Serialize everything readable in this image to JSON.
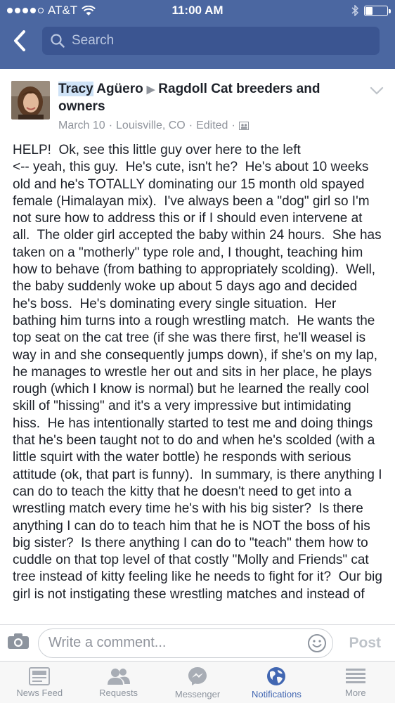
{
  "status_bar": {
    "carrier": "AT&T",
    "time": "11:00 AM",
    "battery_level": 0.3
  },
  "nav": {
    "search_placeholder": "Search"
  },
  "post": {
    "author_first": "Tracy",
    "author_rest": " Agüero",
    "group": "Ragdoll Cat breeders and owners",
    "date": "March 10",
    "location": "Louisville, CO",
    "edited": "Edited",
    "text": "HELP!  Ok, see this little guy over here to the left\n<-- yeah, this guy.  He's cute, isn't he?  He's about 10 weeks old and he's TOTALLY dominating our 15 month old spayed female (Himalayan mix).  I've always been a \"dog\" girl so I'm not sure how to address this or if I should even intervene at all.  The older girl accepted the baby within 24 hours.  She has taken on a \"motherly\" type role and, I thought, teaching him how to behave (from bathing to appropriately scolding).  Well, the baby suddenly woke up about 5 days ago and decided he's boss.  He's dominating every single situation.  Her bathing him turns into a rough wrestling match.  He wants the top seat on the cat tree (if she was there first, he'll weasel is way in and she consequently jumps down), if she's on my lap, he manages to wrestle her out and sits in her place, he plays rough (which I know is normal) but he learned the really cool skill of \"hissing\" and it's a very impressive but intimidating hiss.  He has intentionally started to test me and doing things that he's been taught not to do and when he's scolded (with a little squirt with the water bottle) he responds with serious attitude (ok, that part is funny).  In summary, is there anything I can do to teach the kitty that he doesn't need to get into a wrestling match every time he's with his big sister?  Is there anything I can do to teach him that he is NOT the boss of his big sister?  Is there anything I can do to \"teach\" them how to cuddle on that top level of that costly \"Molly and Friends\" cat tree instead of kitty feeling like he needs to fight for it?  Our big girl is not instigating these wrestling matches and instead of"
  },
  "comment_bar": {
    "placeholder": "Write a comment...",
    "post_label": "Post"
  },
  "tabs": [
    {
      "label": "News Feed",
      "icon": "news-feed-icon"
    },
    {
      "label": "Requests",
      "icon": "friend-requests-icon"
    },
    {
      "label": "Messenger",
      "icon": "messenger-icon"
    },
    {
      "label": "Notifications",
      "icon": "globe-icon",
      "active": true
    },
    {
      "label": "More",
      "icon": "menu-icon"
    }
  ],
  "colors": {
    "brand_blue": "#4b67a1",
    "active_tab": "#4267b2",
    "muted": "#90949c"
  }
}
